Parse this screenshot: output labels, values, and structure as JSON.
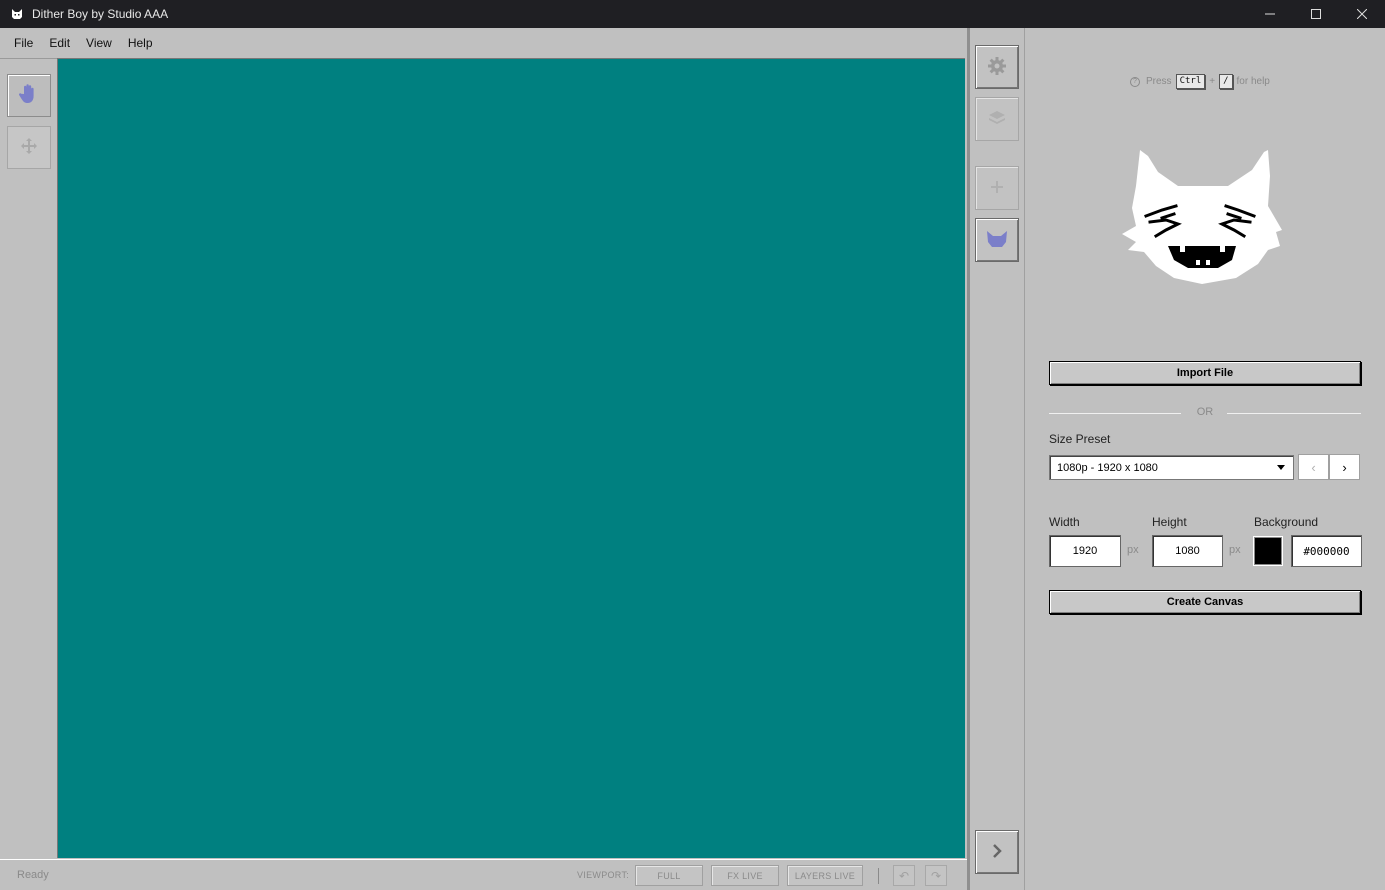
{
  "window": {
    "title": "Dither Boy by Studio AAA",
    "controls": {
      "minimize": "—",
      "maximize": "☐",
      "close": "✕"
    }
  },
  "menu": [
    "File",
    "Edit",
    "View",
    "Help"
  ],
  "colors": {
    "canvas": "#008080",
    "accent_icon": "#7b7fc9",
    "panel_bg": "#c0c0c0",
    "titlebar_bg": "#1f1f23"
  },
  "tools": [
    {
      "icon": "hand-icon",
      "active": true
    },
    {
      "icon": "move-icon",
      "active": false
    }
  ],
  "status": {
    "text": "Ready",
    "viewport_label": "VIEWPORT:",
    "buttons": [
      "FULL",
      "FX LIVE",
      "LAYERS LIVE"
    ],
    "undo": "↶",
    "redo": "↷"
  },
  "sidebar": {
    "buttons": [
      {
        "icon": "gear-icon"
      },
      {
        "icon": "layers-icon"
      },
      {
        "icon": "plus-icon"
      },
      {
        "icon": "cat-icon"
      },
      {
        "icon": "chevron-right-icon"
      }
    ]
  },
  "panel": {
    "help": {
      "press": "Press",
      "key1": "Ctrl",
      "plus": "+",
      "key2": "/",
      "suffix": "for help"
    },
    "import_label": "Import File",
    "or_label": "OR",
    "size_preset_label": "Size Preset",
    "size_preset_value": "1080p - 1920 x 1080",
    "prev": "‹",
    "next": "›",
    "width_label": "Width",
    "height_label": "Height",
    "background_label": "Background",
    "width_value": "1920",
    "height_value": "1080",
    "unit": "px",
    "background_value": "#000000",
    "create_label": "Create Canvas"
  }
}
